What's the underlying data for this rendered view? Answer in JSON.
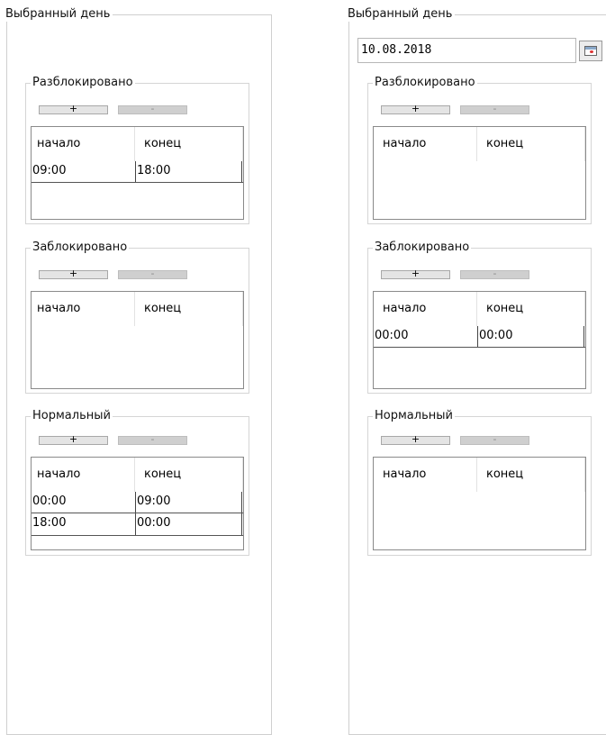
{
  "left_panel": {
    "legend": "Выбранный день",
    "unlocked": {
      "legend": "Разблокировано",
      "add_label": "+",
      "remove_label": "-",
      "col_start": "начало",
      "col_end": "конец",
      "rows": [
        {
          "start": "09:00",
          "end": "18:00"
        }
      ]
    },
    "locked": {
      "legend": "Заблокировано",
      "add_label": "+",
      "remove_label": "-",
      "col_start": "начало",
      "col_end": "конец",
      "rows": []
    },
    "normal": {
      "legend": "Нормальный",
      "add_label": "+",
      "remove_label": "-",
      "col_start": "начало",
      "col_end": "конец",
      "rows": [
        {
          "start": "00:00",
          "end": "09:00"
        },
        {
          "start": "18:00",
          "end": "00:00"
        }
      ]
    }
  },
  "right_panel": {
    "legend": "Выбранный день",
    "date_value": "10.08.2018",
    "calendar_icon": "calendar-icon",
    "unlocked": {
      "legend": "Разблокировано",
      "add_label": "+",
      "remove_label": "-",
      "col_start": "начало",
      "col_end": "конец",
      "rows": []
    },
    "locked": {
      "legend": "Заблокировано",
      "add_label": "+",
      "remove_label": "-",
      "col_start": "начало",
      "col_end": "конец",
      "rows": [
        {
          "start": "00:00",
          "end": "00:00"
        }
      ]
    },
    "normal": {
      "legend": "Нормальный",
      "add_label": "+",
      "remove_label": "-",
      "col_start": "начало",
      "col_end": "конец",
      "rows": []
    }
  }
}
